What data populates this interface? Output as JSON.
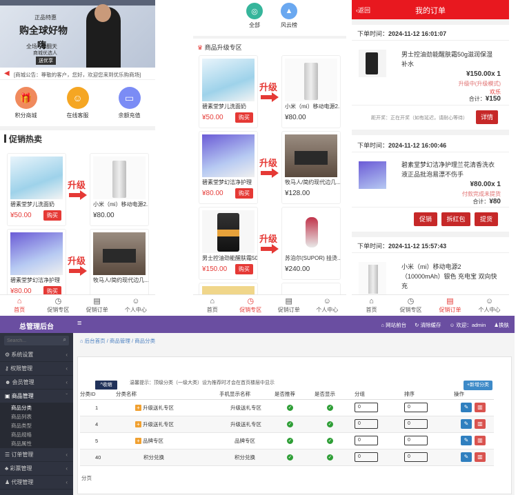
{
  "panel1": {
    "banner": {
      "line1": "正品特惠",
      "line2": "购全球好物",
      "line3": "全场",
      "line4": "嗨",
      "line5": "翻天",
      "line6": "商城优选人",
      "line7": "送优享"
    },
    "notice": "[商城公告：尊敬的客户，您好，欢迎您来到优乐购商场]",
    "shortcuts": [
      {
        "label": "积分商城",
        "icon": "gift-icon",
        "color": "#f08a5d"
      },
      {
        "label": "在线客服",
        "icon": "support-icon",
        "color": "#f5a623"
      },
      {
        "label": "余额充值",
        "icon": "tablet-icon",
        "color": "#7b8cf5"
      }
    ],
    "section_title": "促销热卖",
    "upgrade_label": "升级",
    "left_products": [
      {
        "title": "碧素堂梦儿洗面奶",
        "price": "¥50.00",
        "buy": "购买"
      },
      {
        "title": "碧素堂梦幻洁净护理",
        "price": "¥80.00",
        "buy": "购买"
      }
    ],
    "right_products": [
      {
        "title": "小米（mi）移动电源2...",
        "price": "¥80.00"
      },
      {
        "title": "牧马人/简约现代边几...",
        "price": "¥128.00"
      }
    ],
    "tabs": [
      {
        "label": "首页",
        "icon": "home-icon",
        "active": true
      },
      {
        "label": "促销专区",
        "icon": "clock-icon",
        "active": false
      },
      {
        "label": "促销订单",
        "icon": "order-icon",
        "active": false
      },
      {
        "label": "个人中心",
        "icon": "user-icon",
        "active": false
      }
    ]
  },
  "panel2": {
    "top_icons": [
      {
        "label": "全部",
        "icon": "tag-icon",
        "color": "#36b59b"
      },
      {
        "label": "风云榜",
        "icon": "rank-icon",
        "color": "#6aa8f0"
      }
    ],
    "section_title": "商品升级专区",
    "upgrade_label": "升级",
    "left_products": [
      {
        "title": "碧素堂梦儿洗面奶",
        "price": "¥50.00",
        "buy": "购买"
      },
      {
        "title": "碧素堂梦幻洁净护理",
        "price": "¥80.00",
        "buy": "购买"
      },
      {
        "title": "男士控油劲能醒肤霜50...",
        "price": "¥150.00",
        "buy": "购买"
      }
    ],
    "right_products": [
      {
        "title": "小米（mi）移动电源2...",
        "price": "¥80.00"
      },
      {
        "title": "牧马人/简约现代边几...",
        "price": "¥128.00"
      },
      {
        "title": "苏泊尔(SUPOR) 挂烫...",
        "price": "¥240.00"
      }
    ],
    "tabs": [
      {
        "label": "首页",
        "icon": "home-icon",
        "active": false
      },
      {
        "label": "促销专区",
        "icon": "clock-icon",
        "active": true
      },
      {
        "label": "促销订单",
        "icon": "order-icon",
        "active": false
      },
      {
        "label": "个人中心",
        "icon": "user-icon",
        "active": false
      }
    ]
  },
  "panel3": {
    "back": "返回",
    "title": "我的订单",
    "orders": [
      {
        "time_label": "下单时间：",
        "time": "2024-11-12 16:01:07",
        "name": "男士控油劲能醒肤霜50g滋润保湿补水",
        "price": "¥150.00x 1",
        "status": "升级中(升级模式)",
        "status2": "欢乐",
        "total_label": "合计：",
        "total": "¥150",
        "progress": "距开奖：正在开奖（如有延迟，请耐心等待）",
        "buttons": [
          "详情"
        ]
      },
      {
        "time_label": "下单时间：",
        "time": "2024-11-12 16:00:46",
        "name": "碧素堂梦幻洁净护理兰花清香洗衣液正品批泡易漂不伤手",
        "price": "¥80.00x 1",
        "status": "付款完成未提货",
        "total_label": "合计：",
        "total": "¥80",
        "buttons": [
          "促销",
          "拆红包",
          "提货"
        ]
      },
      {
        "time_label": "下单时间：",
        "time": "2024-11-12 15:57:43",
        "name": "小米（mi）移动电源2（10000mAh）银色 充电宝 双向快充"
      }
    ],
    "tabs": [
      {
        "label": "首页",
        "icon": "home-icon",
        "active": false
      },
      {
        "label": "促销专区",
        "icon": "clock-icon",
        "active": false
      },
      {
        "label": "促销订单",
        "icon": "order-icon",
        "active": true
      },
      {
        "label": "个人中心",
        "icon": "user-icon",
        "active": false
      }
    ]
  },
  "admin": {
    "brand": "总管理后台",
    "menu_toggle": "≡",
    "top_links": [
      "网站前台",
      "清除缓存",
      "欢迎：admin",
      "换肤"
    ],
    "search_placeholder": "Search...",
    "sidebar": [
      {
        "label": "系统设置",
        "icon": "gear-icon"
      },
      {
        "label": "权限管理",
        "icon": "key-icon"
      },
      {
        "label": "会员管理",
        "icon": "users-icon"
      },
      {
        "label": "商品管理",
        "icon": "box-icon",
        "open": true
      }
    ],
    "sidebar_sub": [
      "商品分类",
      "商品列表",
      "商品类型",
      "商品规格",
      "商品属性"
    ],
    "sidebar_after": [
      {
        "label": "订单管理",
        "icon": "list-icon"
      },
      {
        "label": "彩票管理",
        "icon": "ticket-icon"
      },
      {
        "label": "代理管理",
        "icon": "agent-icon"
      }
    ],
    "breadcrumb": [
      "后台首页",
      "商品管理",
      "商品分类"
    ],
    "collapse_btn": "^收缩",
    "tip": "温馨提示：顶级分类（一级大类）设为推荐时才会在首页楼层中显示",
    "add_btn": "+新增分类",
    "columns": [
      "分类ID",
      "分类名称",
      "手机显示名称",
      "是否推荐",
      "是否显示",
      "分组",
      "排序",
      "操作"
    ],
    "rows": [
      {
        "id": "1",
        "name": "升级送礼专区",
        "mobile": "升级送礼专区",
        "plus": true,
        "group": "0",
        "sort": "0"
      },
      {
        "id": "4",
        "name": "升级送礼专区",
        "mobile": "升级送礼专区",
        "plus": true,
        "group": "0",
        "sort": "0"
      },
      {
        "id": "5",
        "name": "品牌专区",
        "mobile": "品牌专区",
        "plus": true,
        "group": "0",
        "sort": "0"
      },
      {
        "id": "40",
        "name": "积分兑换",
        "mobile": "积分兑换",
        "plus": false,
        "group": "0",
        "sort": "0"
      }
    ],
    "footer": "分页"
  }
}
